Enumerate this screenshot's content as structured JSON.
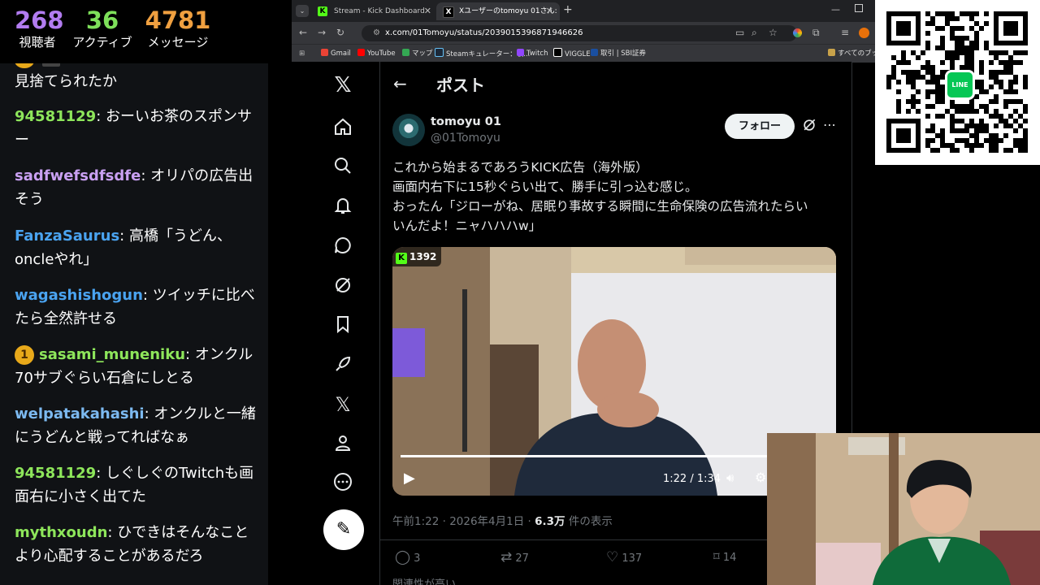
{
  "stats": {
    "viewers_value": "268",
    "viewers_label": "視聴者",
    "active_value": "36",
    "active_label": "アクティブ",
    "messages_value": "4781",
    "messages_label": "メッセージ"
  },
  "chat": {
    "partial_text": "見捨てられたか",
    "messages": [
      {
        "user": "94581129",
        "text": "おーいお茶のスポンサー",
        "color": "#8ee65b"
      },
      {
        "user": "sadfwefsdfsdfe",
        "text": "オリパの広告出そう",
        "color": "#c9a0f2"
      },
      {
        "user": "FanzaSaurus",
        "text": "高橋「うどん、oncleやれ」",
        "color": "#4aa3f0"
      },
      {
        "user": "wagashishogun",
        "text": "ツイッチに比べたら全然許せる",
        "color": "#4aa3f0"
      },
      {
        "user": "sasami_muneniku",
        "text": "オンクル70サブぐらい石倉にしとる",
        "color": "#8ee65b",
        "badge": "1"
      },
      {
        "user": "welpatakahashi",
        "text": "オンクルと一緒にうどんと戦ってればなぁ",
        "color": "#7cb9f0"
      },
      {
        "user": "94581129",
        "text": "しぐしぐのTwitchも画面右に小さく出てた",
        "color": "#8ee65b"
      },
      {
        "user": "mythxoudn",
        "text": "ひできはそんなことより心配することがあるだろ",
        "color": "#8ee65b"
      }
    ]
  },
  "browser": {
    "tabs": [
      {
        "label": "Stream - Kick Dashboard"
      },
      {
        "label": "Xユーザーのtomoyu 01さん:"
      }
    ],
    "url": "x.com/01Tomoyu/status/2039015396871946626",
    "bookmarks": [
      "Gmail",
      "YouTube",
      "マップ",
      "Steamキュレーター：収...",
      "Twitch",
      "VIGGLE",
      "取引 | SBI証券"
    ],
    "bookmarks_right": "すべてのブック"
  },
  "x": {
    "header_title": "ポスト",
    "author_name": "tomoyu 01",
    "author_handle": "@01Tomoyu",
    "follow_label": "フォロー",
    "body_lines": [
      "これから始まるであろうKICK広告（海外版）",
      "画面内右下に15秒ぐらい出て、勝手に引っ込む感じ。",
      "おったん「ジローがね、居眠り事故する瞬間に生命保険の広告流れたらい",
      "いんだよ！ニャハハハw」"
    ],
    "video_badge": "1392",
    "video_time": "1:22 / 1:34",
    "video_progress": 0.876,
    "meta_time": "午前1:22 · 2026年4月1日 · ",
    "meta_views": "6.3万",
    "meta_views_suffix": " 件の表示",
    "replies": "3",
    "reposts": "27",
    "likes": "137",
    "bookmarks": "14",
    "related": "関連性が高い"
  }
}
